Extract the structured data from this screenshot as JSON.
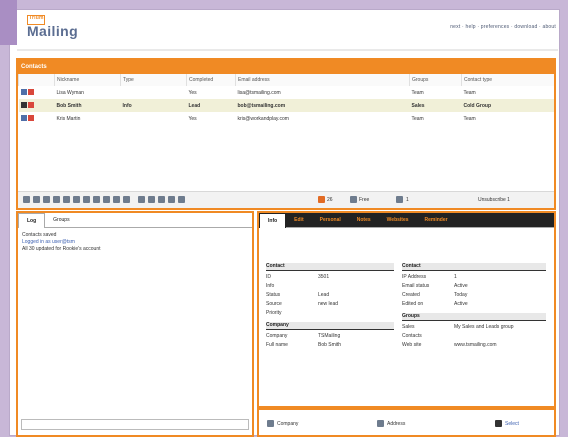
{
  "app": {
    "logo_small": "Trium",
    "logo_big": "Mailing",
    "top_links": "next · help · preferences · download · about"
  },
  "contacts_panel": {
    "title": "Contacts",
    "columns": [
      "Nickname",
      "Type",
      "Completed",
      "Email address",
      "Groups",
      "Contact type"
    ],
    "rows": [
      {
        "nick": "Lisa Wyman",
        "type": "",
        "comp": "Yes",
        "email": "lisa@tsmailing.com",
        "group": "Team",
        "ctype": "Team"
      },
      {
        "nick": "Bob Smith",
        "type": "Info",
        "comp": "Lead",
        "email": "bob@tsmailing.com",
        "group": "Sales",
        "ctype": "Cold Group"
      },
      {
        "nick": "Kris Martin",
        "type": "",
        "comp": "Yes",
        "email": "kris@workandplay.com",
        "group": "Team",
        "ctype": "Team"
      }
    ],
    "toolbar_text": [
      "26",
      "Free",
      "1",
      "Unsubscribe  1"
    ]
  },
  "log_panel": {
    "tabs": [
      "Log",
      "Groups"
    ],
    "lines": [
      "Contacts saved",
      "Logged in as user@tsm",
      "All 30 updated for Rookie's account"
    ]
  },
  "detail_panel": {
    "tabs": [
      "Info",
      "Edit",
      "Personal",
      "Notes",
      "Websites",
      "Reminder"
    ],
    "left_header": "Contact",
    "left_rows": [
      [
        "ID",
        "3501 "
      ],
      [
        "Info",
        ""
      ],
      [
        "Status",
        "Lead"
      ],
      [
        "Source",
        "new lead"
      ],
      [
        "Priority",
        ""
      ]
    ],
    "left_header2": "Company",
    "left_rows2": [
      [
        "Company",
        "TSMailing"
      ],
      [
        "Full name",
        "Bob Smith"
      ]
    ],
    "right_header": "Contact",
    "right_rows": [
      [
        "IP Address",
        "1"
      ],
      [
        "Email status",
        "Active"
      ],
      [
        "Created",
        "Today"
      ],
      [
        "Edited on",
        "Active"
      ]
    ],
    "right_header2": "Groups",
    "right_rows2": [
      [
        "Sales",
        "My Sales and Leads group"
      ],
      [
        "Contacts",
        ""
      ],
      [
        "Web site",
        "www.tsmailing.com"
      ]
    ]
  },
  "footer": {
    "labels": [
      "Company",
      "Address",
      "Select"
    ]
  }
}
